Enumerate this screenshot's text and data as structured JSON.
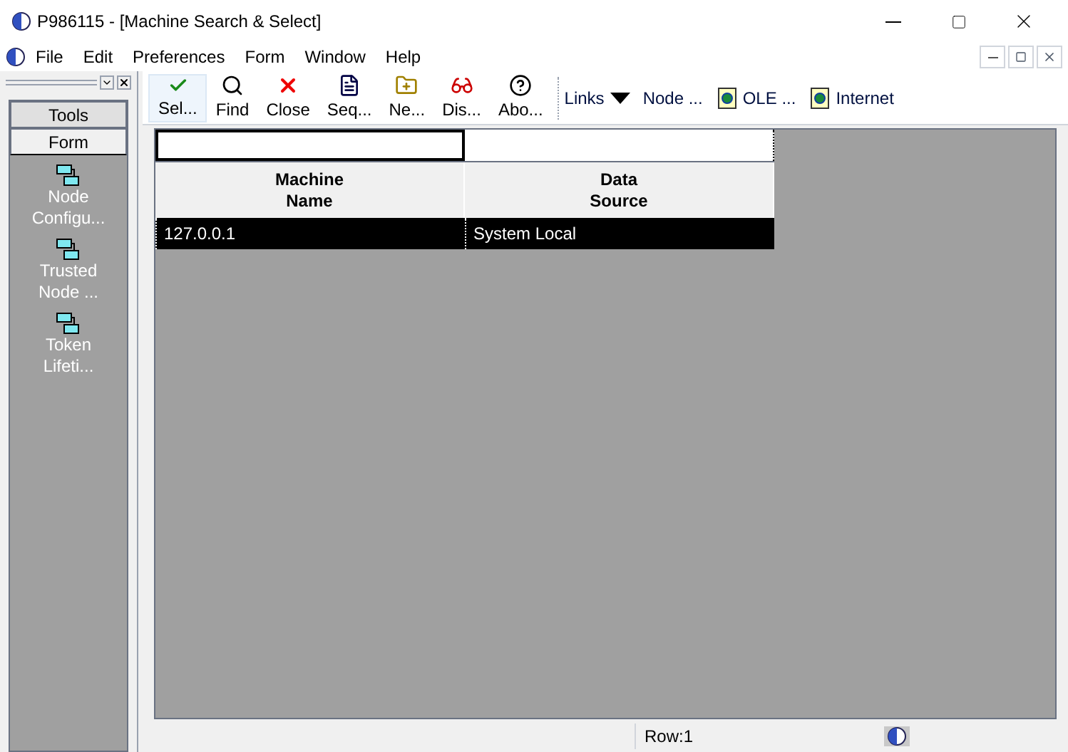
{
  "window": {
    "title": "P986115 - [Machine Search & Select]"
  },
  "menu": [
    "File",
    "Edit",
    "Preferences",
    "Form",
    "Window",
    "Help"
  ],
  "side_panel": {
    "tabs": [
      {
        "label": "Tools",
        "selected": false
      },
      {
        "label": "Form",
        "selected": true
      }
    ],
    "items": [
      {
        "label": "Node Configu..."
      },
      {
        "label": "Trusted Node ..."
      },
      {
        "label": "Token Lifeti..."
      }
    ]
  },
  "toolbar": [
    {
      "label": "Sel...",
      "kind": "check",
      "selected": true
    },
    {
      "label": "Find",
      "kind": "find",
      "selected": false
    },
    {
      "label": "Close",
      "kind": "close",
      "selected": false
    },
    {
      "label": "Seq...",
      "kind": "seq",
      "selected": false
    },
    {
      "label": "Ne...",
      "kind": "new",
      "selected": false
    },
    {
      "label": "Dis...",
      "kind": "display",
      "selected": false
    },
    {
      "label": "Abo...",
      "kind": "about",
      "selected": false
    }
  ],
  "links": {
    "label": "Links",
    "items": [
      "Node ...",
      "OLE ...",
      "Internet"
    ]
  },
  "table": {
    "columns": [
      "Machine\nName",
      "Data\nSource"
    ],
    "rows": [
      {
        "cells": [
          "127.0.0.1",
          "System Local"
        ],
        "selected": true
      }
    ]
  },
  "status_bar": {
    "row": "Row:1"
  }
}
